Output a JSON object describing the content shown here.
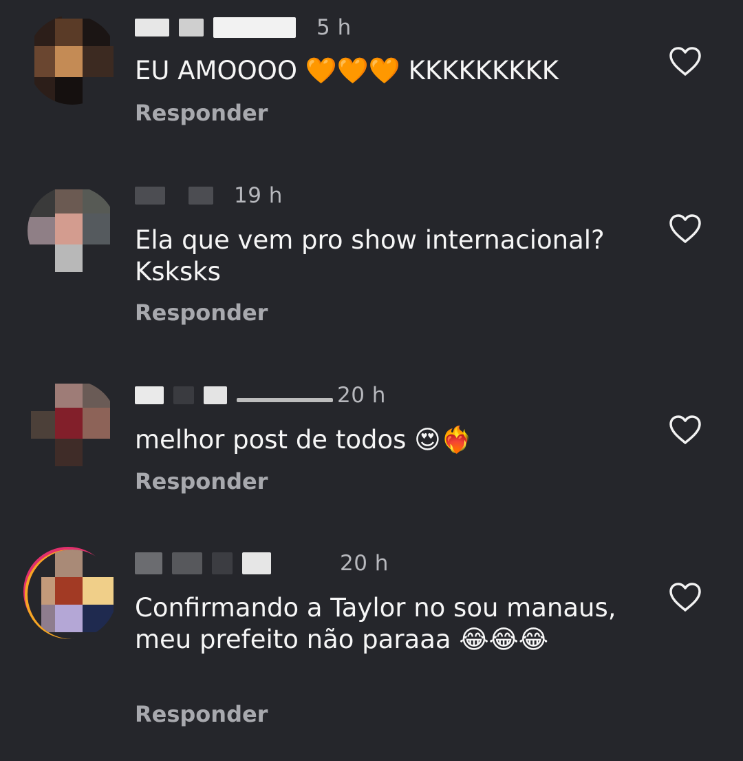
{
  "comments": [
    {
      "time": "5 h",
      "text": "EU AMOOOO 🧡🧡🧡 KKKKKKKKK",
      "reply_label": "Responder"
    },
    {
      "time": "19 h",
      "text": "Ela que vem pro show internacional? Ksksks",
      "reply_label": "Responder"
    },
    {
      "time": "20 h",
      "text": "melhor post de todos 😍❤️‍🔥",
      "reply_label": "Responder"
    },
    {
      "time": "20 h",
      "text": "Confirmando a Taylor no sou manaus, meu prefeito não paraaa 😂😂😂",
      "reply_label": "Responder"
    }
  ],
  "icons": {
    "like": "heart-outline-icon"
  },
  "colors": {
    "background": "#25262b",
    "text": "#f6f6f6",
    "muted": "#a8a9ae"
  }
}
